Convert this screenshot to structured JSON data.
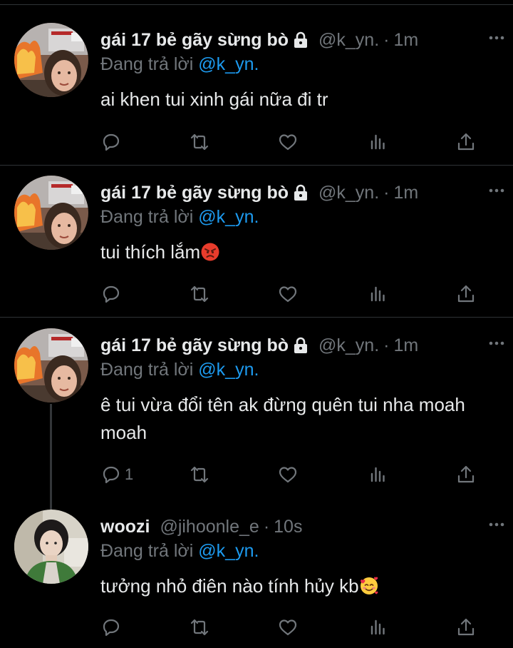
{
  "reply_prefix": "Đang trả lời",
  "colors": {
    "accent": "#1d9bf0",
    "muted": "#71767b",
    "text": "#e7e9ea",
    "divider": "#2f3336"
  },
  "tweets": [
    {
      "name": "gái 17 bẻ gãy sừng bò",
      "handle": "@k_yn.",
      "dot": "·",
      "time": "1m",
      "replying_to": "@k_yn.",
      "text": "ai khen tui xinh gái nữa đi tr",
      "emoji": "",
      "reply_count": "",
      "avatar": "girl-fire-avatar"
    },
    {
      "name": "gái 17 bẻ gãy sừng bò",
      "handle": "@k_yn.",
      "dot": "·",
      "time": "1m",
      "replying_to": "@k_yn.",
      "text": "tui thích lắm",
      "emoji": "angry-face-emoji",
      "reply_count": "",
      "avatar": "girl-fire-avatar"
    },
    {
      "name": "gái 17 bẻ gãy sừng bò",
      "handle": "@k_yn.",
      "dot": "·",
      "time": "1m",
      "replying_to": "@k_yn.",
      "text": "ê tui vừa đổi tên ak đừng quên tui nha moah moah",
      "emoji": "",
      "reply_count": "1",
      "avatar": "girl-fire-avatar"
    },
    {
      "name": "woozi",
      "handle": "@jihoonle_e",
      "dot": "·",
      "time": "10s",
      "replying_to": "@k_yn.",
      "text": "tưởng nhỏ điên nào tính hủy kb",
      "emoji": "smiling-face-hearts-emoji",
      "reply_count": "",
      "avatar": "boy-avatar"
    }
  ],
  "icons": [
    "lock-icon",
    "more-icon",
    "reply-icon",
    "retweet-icon",
    "like-icon",
    "views-icon",
    "share-icon"
  ]
}
